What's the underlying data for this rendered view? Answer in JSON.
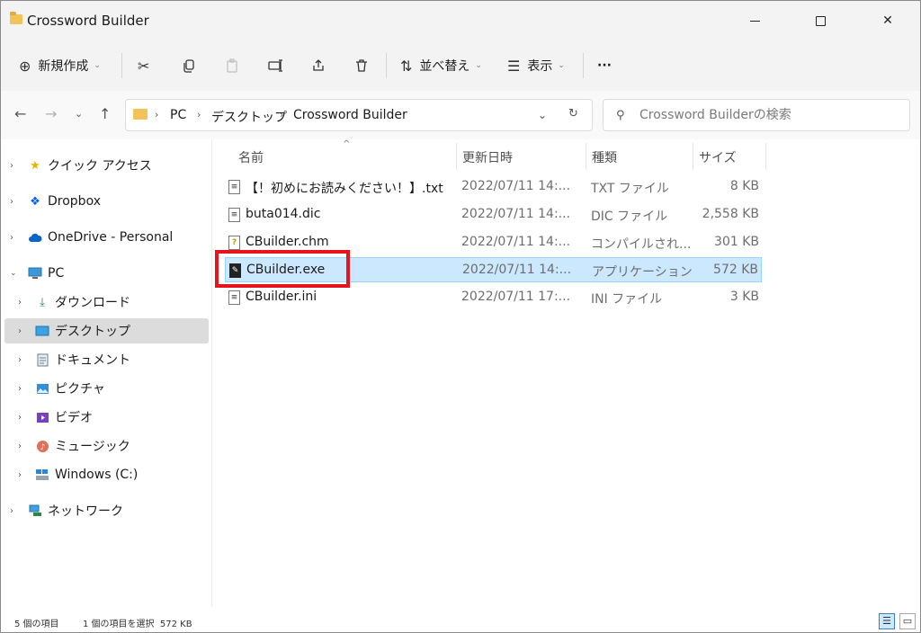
{
  "window": {
    "title": "Crossword Builder"
  },
  "toolbar": {
    "new_label": "新規作成",
    "sort_label": "並べ替え",
    "view_label": "表示",
    "more_label": "···"
  },
  "address": {
    "crumbs": [
      "PC",
      "デスクトップ",
      "Crossword Builder"
    ]
  },
  "search": {
    "placeholder": "Crossword Builderの検索"
  },
  "nav": {
    "items": [
      {
        "label": "クイック アクセス",
        "icon": "star-icon"
      },
      {
        "label": "Dropbox",
        "icon": "dropbox-icon"
      },
      {
        "label": "OneDrive - Personal",
        "icon": "cloud-icon"
      },
      {
        "label": "PC",
        "icon": "computer-icon"
      },
      {
        "label": "ダウンロード",
        "icon": "download-icon"
      },
      {
        "label": "デスクトップ",
        "icon": "desktop-icon"
      },
      {
        "label": "ドキュメント",
        "icon": "document-icon"
      },
      {
        "label": "ピクチャ",
        "icon": "picture-icon"
      },
      {
        "label": "ビデオ",
        "icon": "video-icon"
      },
      {
        "label": "ミュージック",
        "icon": "music-icon"
      },
      {
        "label": "Windows (C:)",
        "icon": "drive-icon"
      },
      {
        "label": "ネットワーク",
        "icon": "network-icon"
      }
    ]
  },
  "columns": {
    "name": "名前",
    "date": "更新日時",
    "type": "種類",
    "size": "サイズ"
  },
  "files": [
    {
      "name": "【！初めにお読みください！】.txt",
      "date": "2022/07/11 14:...",
      "type": "TXT ファイル",
      "size": "8 KB"
    },
    {
      "name": "buta014.dic",
      "date": "2022/07/11 14:...",
      "type": "DIC ファイル",
      "size": "2,558 KB"
    },
    {
      "name": "CBuilder.chm",
      "date": "2022/07/11 14:...",
      "type": "コンパイルされ...",
      "size": "301 KB"
    },
    {
      "name": "CBuilder.exe",
      "date": "2022/07/11 14:...",
      "type": "アプリケーション",
      "size": "572 KB"
    },
    {
      "name": "CBuilder.ini",
      "date": "2022/07/11 17:...",
      "type": "INI ファイル",
      "size": "3 KB"
    }
  ],
  "status": {
    "count": "5 個の項目",
    "selection": "1 個の項目を選択  572 KB"
  },
  "colors": {
    "accent": "#0067c0",
    "selection_bg": "#cce8ff",
    "highlight": "#e8141b"
  }
}
